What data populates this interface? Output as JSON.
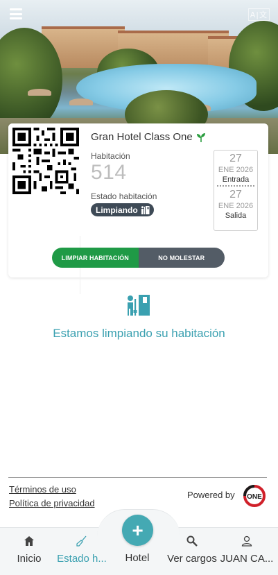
{
  "header": {
    "menu_icon": "hamburger-menu-icon",
    "language_icon": "language-icon",
    "language_text": "A|文"
  },
  "reservation": {
    "hotel_name": "Gran Hotel Class One",
    "eco_icon": "sprout-icon",
    "room_label": "Habitación",
    "room_number": "514",
    "state_label": "Estado habitación",
    "state_value": "Limpiando",
    "state_icon": "cleaning-icon",
    "checkin": {
      "day": "27",
      "month_year": "ENE 2026",
      "label": "Entrada"
    },
    "checkout": {
      "day": "27",
      "month_year": "ENE 2026",
      "label": "Salida"
    }
  },
  "actions": {
    "clean_room": "LIMPIAR HABITACIÓN",
    "do_not_disturb": "NO MOLESTAR",
    "active": "clean_room"
  },
  "status": {
    "icon": "cleaning-icon",
    "message": "Estamos limpiando su habitación"
  },
  "footer": {
    "terms": "Términos de uso",
    "privacy": "Política de privacidad",
    "powered_by": "Powered by",
    "logo_text": "ONE"
  },
  "nav": {
    "fab_label": "+",
    "items": [
      {
        "label": "Inicio",
        "icon": "home-icon"
      },
      {
        "label": "Estado h...",
        "icon": "broom-icon"
      },
      {
        "label": "Hotel",
        "icon": "plus-icon"
      },
      {
        "label": "Ver cargos",
        "icon": "search-icon"
      },
      {
        "label": "JUAN CA...",
        "icon": "user-icon"
      }
    ]
  },
  "colors": {
    "accent": "#3aa0b0",
    "green": "#1f9a46",
    "dark_button": "#535c66",
    "badge": "#3e4a56",
    "logo_red": "#d0202a"
  }
}
